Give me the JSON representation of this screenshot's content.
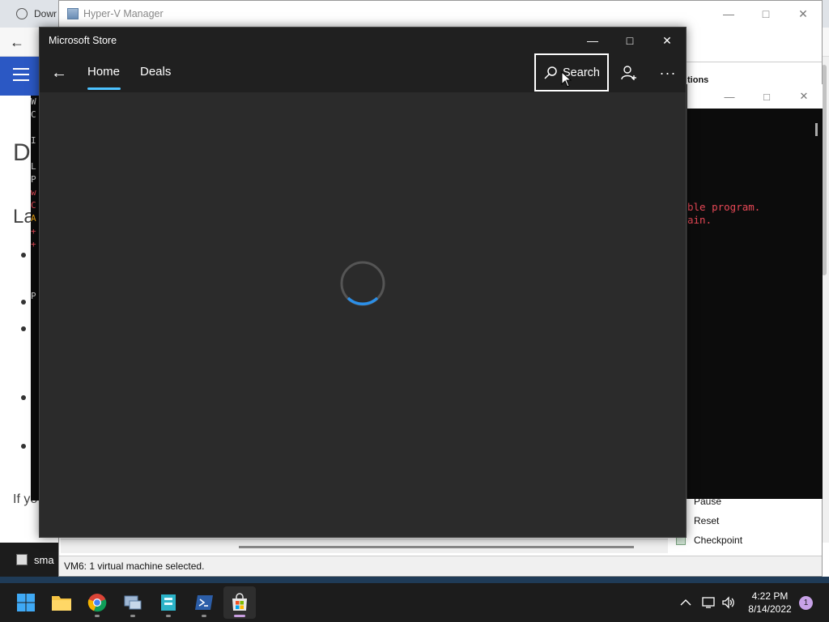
{
  "browser": {
    "tab_title": "Dowr",
    "page_heading": "Di",
    "page_subheading": "La",
    "page_text": "If yo",
    "bottom_label": "sma"
  },
  "terminal_left": {
    "lines": [
      "W",
      "C",
      "",
      "I",
      "",
      "L",
      "P",
      "w",
      "C",
      "A",
      "+",
      "+",
      "",
      "",
      "",
      "P"
    ]
  },
  "hyperv": {
    "title": "Hyper-V Manager",
    "actions_header": "tions",
    "actions": [
      "Pause",
      "Reset",
      "Checkpoint"
    ],
    "status": "VM6:  1 virtual machine selected."
  },
  "vm_console": {
    "error_line_1": "ble program.",
    "error_line_2": "ain."
  },
  "store": {
    "title": "Microsoft Store",
    "tabs": [
      {
        "label": "Home",
        "active": true
      },
      {
        "label": "Deals",
        "active": false
      }
    ],
    "search_label": "Search",
    "state": "loading"
  },
  "taskbar": {
    "apps": [
      "start-icon",
      "file-explorer-icon",
      "chrome-icon",
      "hyper-v-manager-icon",
      "hyper-v-vm-icon",
      "powershell-icon",
      "microsoft-store-icon"
    ],
    "active_app": "microsoft-store-icon",
    "time": "4:22 PM",
    "date": "8/14/2022",
    "notification_count": "1"
  },
  "colors": {
    "accent": "#4cc2ff",
    "store_bg": "#2b2b2b",
    "header_blue": "#2b58c4",
    "error_red": "#e74856"
  }
}
